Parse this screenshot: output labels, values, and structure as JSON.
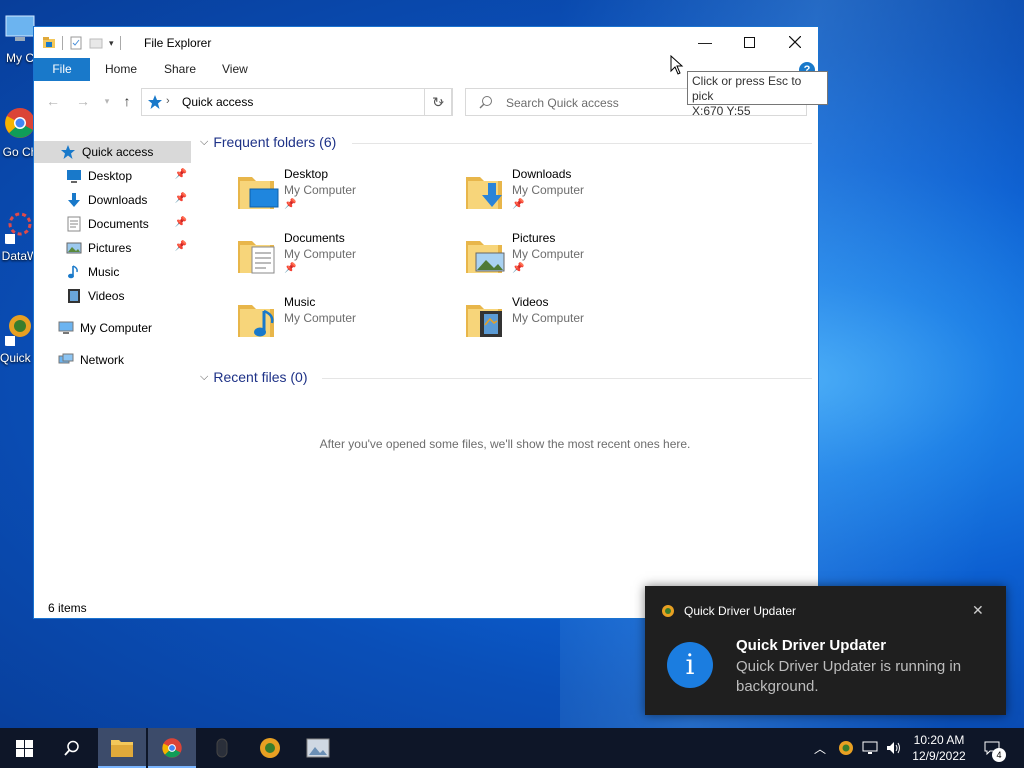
{
  "desktop": {
    "icons": [
      {
        "label": "My C"
      },
      {
        "label": "Go Ch"
      },
      {
        "label": "DataW"
      },
      {
        "label": "Quick Up"
      }
    ]
  },
  "explorer": {
    "title": "File Explorer",
    "ribbon_tabs": [
      "File",
      "Home",
      "Share",
      "View"
    ],
    "address": "Quick access",
    "search_placeholder": "Search Quick access",
    "sidebar": [
      {
        "label": "Quick access",
        "icon": "star-icon",
        "active": true
      },
      {
        "label": "Desktop",
        "icon": "desktop-folder-icon",
        "pinned": true
      },
      {
        "label": "Downloads",
        "icon": "downloads-folder-icon",
        "pinned": true
      },
      {
        "label": "Documents",
        "icon": "documents-folder-icon",
        "pinned": true
      },
      {
        "label": "Pictures",
        "icon": "pictures-folder-icon",
        "pinned": true
      },
      {
        "label": "Music",
        "icon": "music-folder-icon"
      },
      {
        "label": "Videos",
        "icon": "videos-folder-icon"
      },
      {
        "label": "My Computer",
        "icon": "computer-icon"
      },
      {
        "label": "Network",
        "icon": "network-icon"
      }
    ],
    "frequent_header": "Frequent folders (6)",
    "frequent": [
      {
        "name": "Desktop",
        "location": "My Computer",
        "pinned": true
      },
      {
        "name": "Downloads",
        "location": "My Computer",
        "pinned": true
      },
      {
        "name": "Documents",
        "location": "My Computer",
        "pinned": true
      },
      {
        "name": "Pictures",
        "location": "My Computer",
        "pinned": true
      },
      {
        "name": "Music",
        "location": "My Computer",
        "pinned": false
      },
      {
        "name": "Videos",
        "location": "My Computer",
        "pinned": false
      }
    ],
    "recent_header": "Recent files (0)",
    "recent_empty": "After you've opened some files, we'll show the most recent ones here.",
    "status": "6 items"
  },
  "tooltip": {
    "line1": "Click or press Esc to pick",
    "line2": "X:670  Y:55"
  },
  "toast": {
    "app_name": "Quick Driver Updater",
    "title": "Quick Driver Updater",
    "body": "Quick Driver Updater is running in background."
  },
  "taskbar": {
    "time": "10:20 AM",
    "date": "12/9/2022",
    "notification_count": "4"
  },
  "colors": {
    "accent": "#1979ca",
    "folder": "#f3c75a",
    "taskbar": "#0e1628"
  }
}
